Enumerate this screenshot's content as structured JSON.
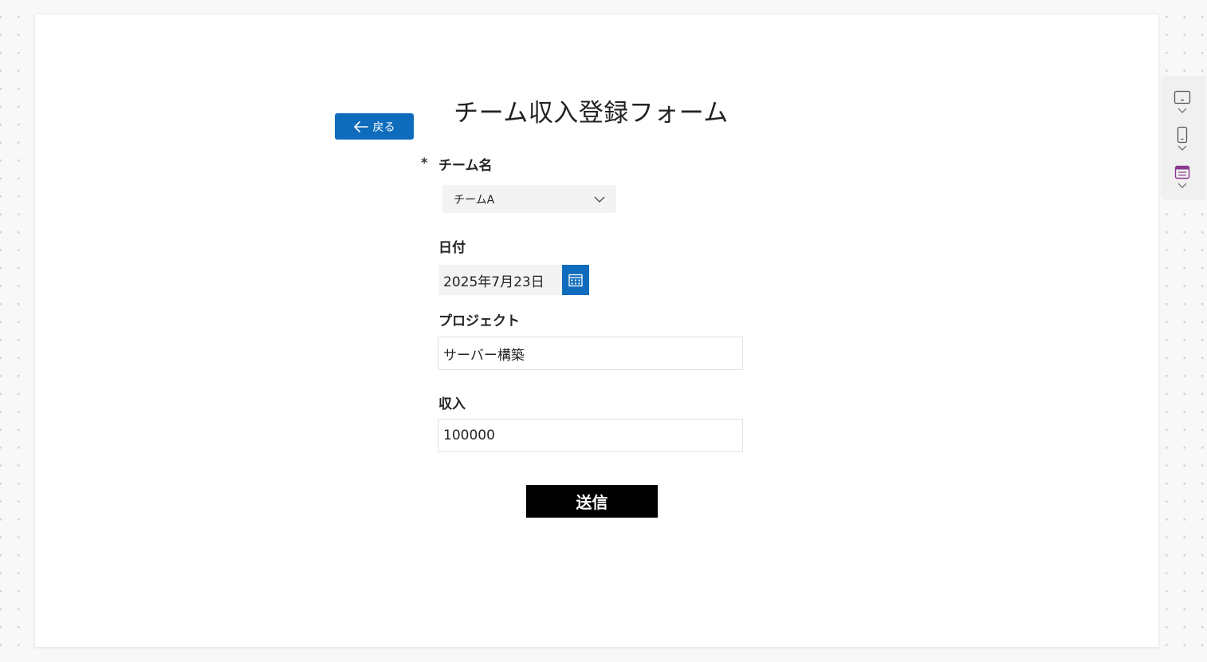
{
  "form": {
    "title": "チーム収入登録フォーム",
    "back_label": "戻る",
    "required_mark": "*",
    "team": {
      "label": "チーム名",
      "value": "チームA"
    },
    "date": {
      "label": "日付",
      "value": "2025年7月23日"
    },
    "project": {
      "label": "プロジェクト",
      "value": "サーバー構築"
    },
    "income": {
      "label": "収入",
      "value": "100000"
    },
    "submit_label": "送信"
  },
  "colors": {
    "primary_blue": "#0f6cbd",
    "submit_bg": "#000000",
    "input_bg": "#f3f3f3",
    "rail_accent": "#8a3a8f"
  },
  "rail": {
    "icons": [
      "tablet-icon",
      "phone-icon",
      "form-icon"
    ]
  }
}
